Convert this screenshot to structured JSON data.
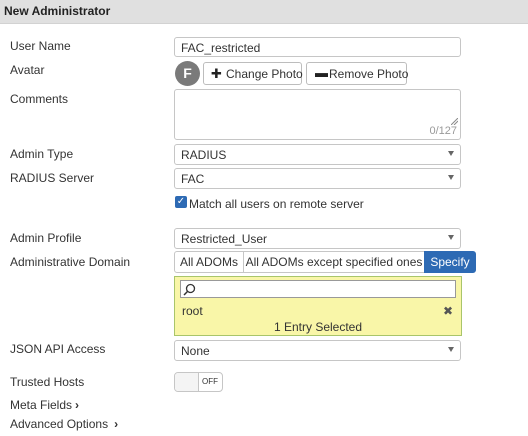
{
  "window": {
    "title": "New Administrator"
  },
  "form": {
    "user_name": {
      "label": "User Name",
      "value": "FAC_restricted"
    },
    "avatar": {
      "label": "Avatar",
      "initial": "F",
      "change_label": "Change Photo",
      "remove_label": "Remove Photo",
      "change_icon": "plus-icon",
      "remove_icon": "minus-icon"
    },
    "comments": {
      "label": "Comments",
      "value": "",
      "counter": "0/127"
    },
    "admin_type": {
      "label": "Admin Type",
      "value": "RADIUS"
    },
    "radius_server": {
      "label": "RADIUS Server",
      "value": "FAC"
    },
    "match_all": {
      "label": "Match all users on remote server",
      "checked": true
    },
    "admin_profile": {
      "label": "Admin Profile",
      "value": "Restricted_User"
    },
    "admin_domain": {
      "label": "Administrative Domain",
      "options": [
        "All ADOMs",
        "All ADOMs except specified ones",
        "Specify"
      ],
      "selected": "Specify",
      "search_placeholder": "",
      "entries": [
        "root"
      ],
      "selected_count": "1 Entry Selected"
    },
    "json_api": {
      "label": "JSON API Access",
      "value": "None"
    },
    "trusted_hosts": {
      "label": "Trusted Hosts",
      "toggle": "OFF"
    },
    "meta_fields": {
      "label": "Meta Fields"
    },
    "advanced_options": {
      "label": "Advanced Options"
    }
  },
  "colors": {
    "accent": "#2d6ab4",
    "highlight_box": "#f9f6a8",
    "header_bg": "#e0e0e0"
  }
}
